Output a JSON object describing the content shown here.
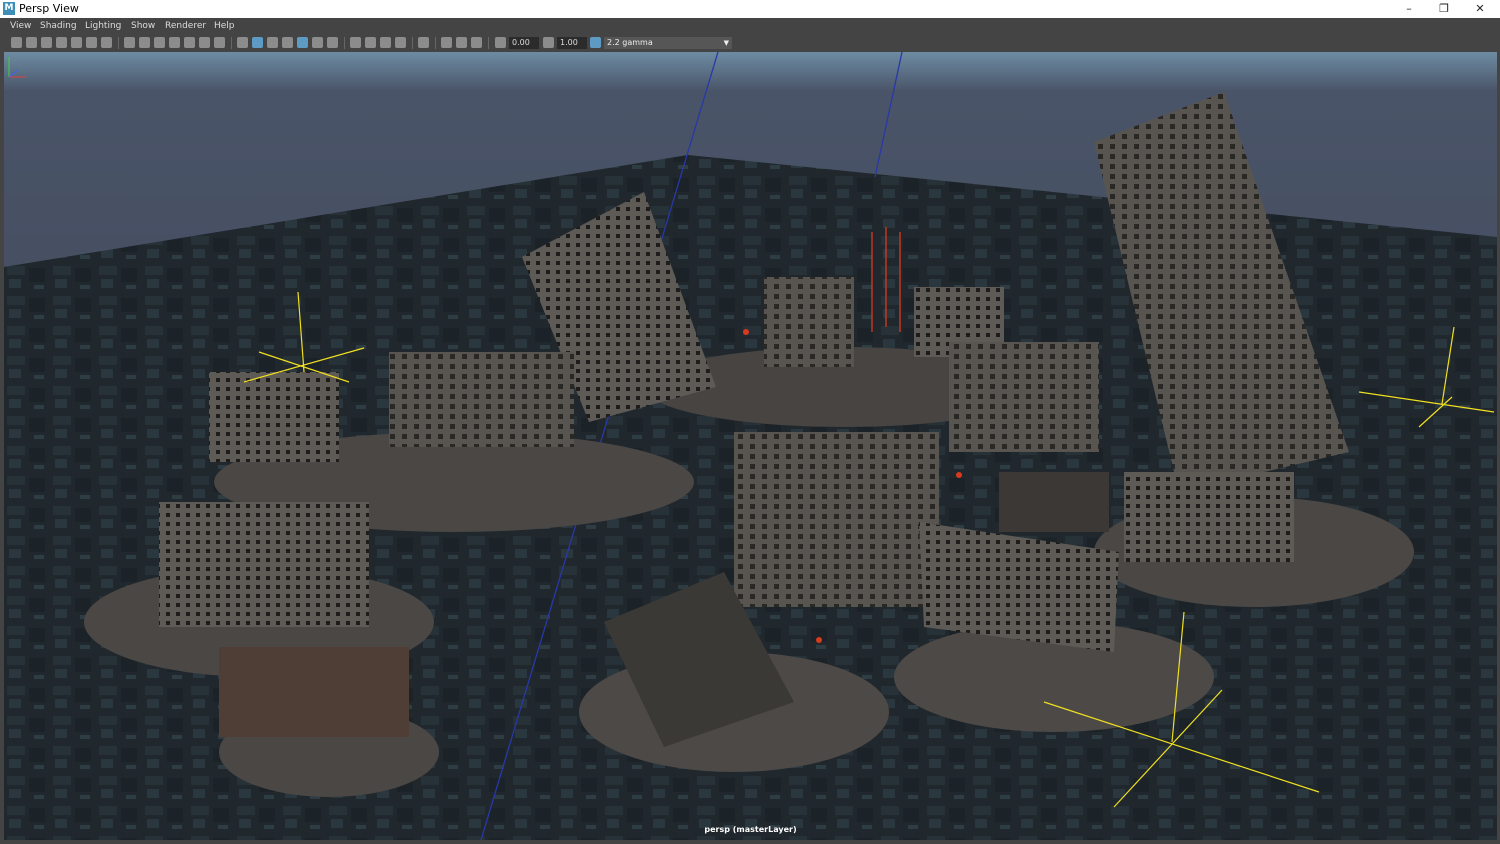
{
  "window": {
    "title": "Persp View",
    "app_icon_letter": "M",
    "minimize_glyph": "–",
    "maximize_glyph": "❐",
    "close_glyph": "✕"
  },
  "menu": {
    "items": [
      {
        "label": "View"
      },
      {
        "label": "Shading"
      },
      {
        "label": "Lighting"
      },
      {
        "label": "Show"
      },
      {
        "label": "Renderer"
      },
      {
        "label": "Help"
      }
    ]
  },
  "toolbar": {
    "exposure_value": "0.00",
    "gamma_value": "1.00",
    "color_profile": "2.2 gamma"
  },
  "viewport": {
    "camera_label": "persp (masterLayer)"
  },
  "colors": {
    "accent": "#5d9bc4",
    "ground_grid": "#2a343a",
    "sky": "#3d4352",
    "horizon": "#6f8fa5",
    "gizmo": "#f0e020",
    "camera_line": "#2838a8"
  }
}
